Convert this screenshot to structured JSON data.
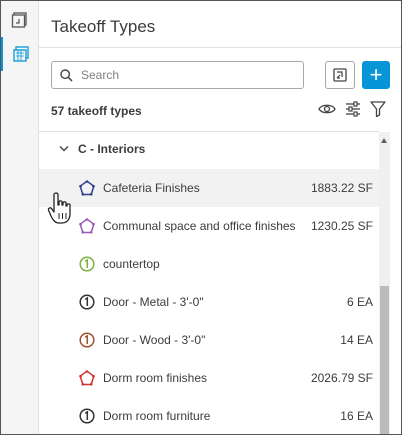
{
  "panel": {
    "title": "Takeoff Types",
    "search_placeholder": "Search",
    "count_label": "57 takeoff types",
    "add_label": "+"
  },
  "colors": {
    "accent": "#0696d7",
    "navy": "#2c3e8c",
    "purple": "#9b59b6",
    "green": "#7cb342",
    "dark": "#333333",
    "brown": "#a0522d",
    "red": "#d32f2f"
  },
  "group": {
    "label": "C - Interiors",
    "expanded": true
  },
  "items": [
    {
      "name": "Cafeteria Finishes",
      "qty": "1883.22 SF",
      "icon": "pentagon-icon",
      "color": "#2c3e8c",
      "hover": true
    },
    {
      "name": "Communal space and office finishes",
      "qty": "1230.25 SF",
      "icon": "pentagon-icon",
      "color": "#9b59b6"
    },
    {
      "name": "countertop",
      "qty": "",
      "icon": "count-circle-icon",
      "color": "#7cb342"
    },
    {
      "name": "Door - Metal - 3'-0\"",
      "qty": "6 EA",
      "icon": "count-circle-icon",
      "color": "#333333"
    },
    {
      "name": "Door - Wood - 3'-0\"",
      "qty": "14 EA",
      "icon": "count-circle-icon",
      "color": "#a0522d"
    },
    {
      "name": "Dorm room finishes",
      "qty": "2026.79 SF",
      "icon": "pentagon-icon",
      "color": "#d32f2f"
    },
    {
      "name": "Dorm room furniture",
      "qty": "16 EA",
      "icon": "count-circle-icon",
      "color": "#333333"
    }
  ]
}
